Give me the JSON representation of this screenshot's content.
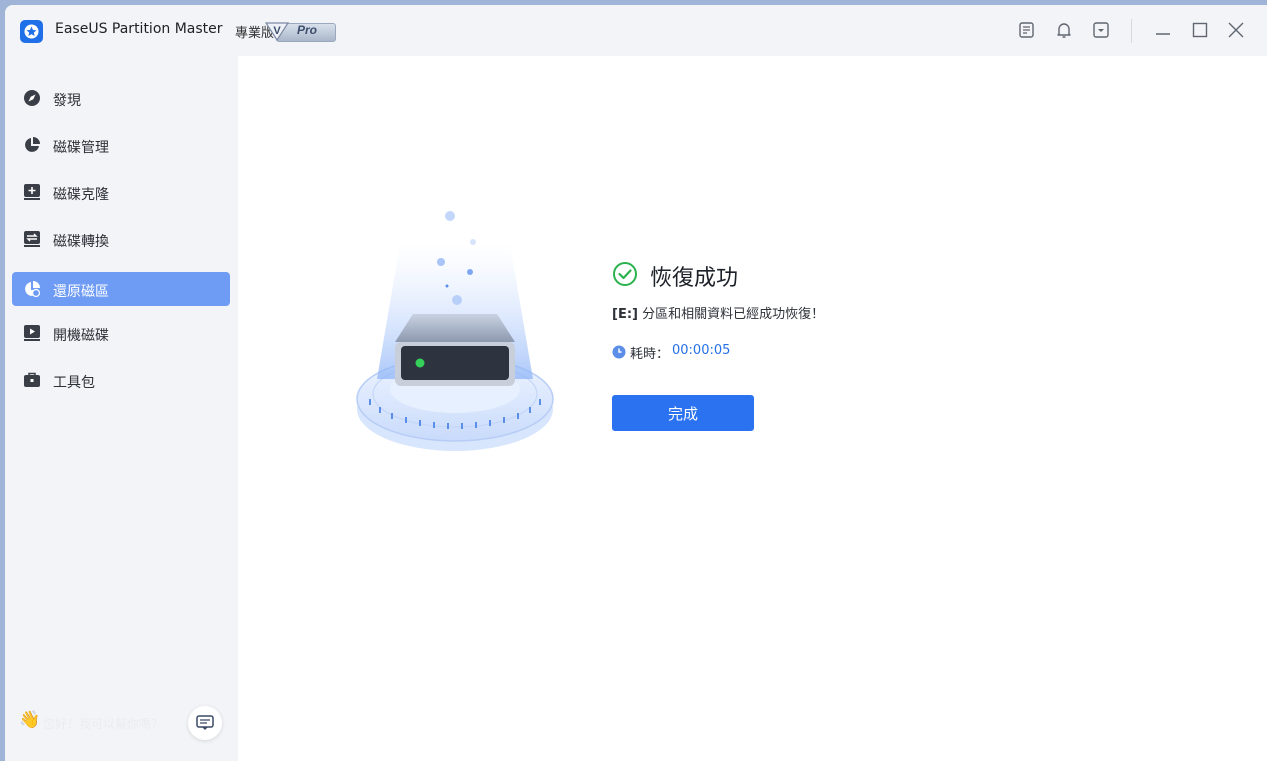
{
  "titlebar": {
    "app_name": "EaseUS Partition Master",
    "edition": "專業版",
    "badge": "Pro",
    "badge_letter": "V",
    "icons": [
      "notes-icon",
      "bell-icon",
      "dropdown-menu-icon",
      "minimize-icon",
      "maximize-icon",
      "close-icon"
    ]
  },
  "sidebar": {
    "items": [
      {
        "label": "發現",
        "icon": "compass-icon"
      },
      {
        "label": "磁碟管理",
        "icon": "pie-chart-icon"
      },
      {
        "label": "磁碟克隆",
        "icon": "clone-plus-icon"
      },
      {
        "label": "磁碟轉換",
        "icon": "convert-icon"
      },
      {
        "label": "還原磁區",
        "icon": "recover-partition-icon"
      },
      {
        "label": "開機磁碟",
        "icon": "boot-disk-icon"
      },
      {
        "label": "工具包",
        "icon": "toolbox-icon"
      }
    ],
    "active_index": 4,
    "feedback_text": "您好！我可以幫你嗎？"
  },
  "result": {
    "title": "恢復成功",
    "drive_label": "[E:]",
    "message": " 分區和相關資料已經成功恢復！",
    "elapsed_label": "耗時：",
    "elapsed_value": "00:00:05",
    "done_label": "完成"
  },
  "colors": {
    "accent": "#2a72f0",
    "active_nav": "#6e9bf4",
    "success": "#2bb24c",
    "sidebar_bg": "#f3f4f8"
  }
}
